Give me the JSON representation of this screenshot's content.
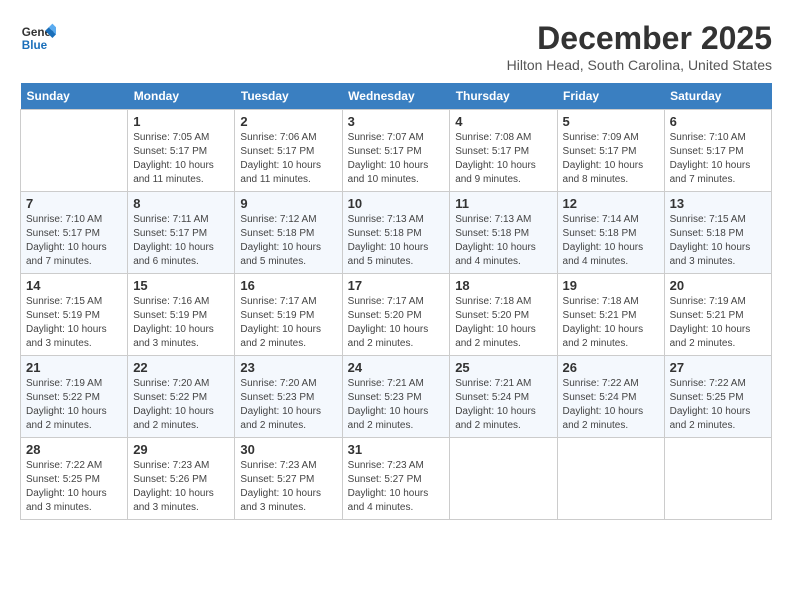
{
  "header": {
    "logo_line1": "General",
    "logo_line2": "Blue",
    "month_title": "December 2025",
    "location": "Hilton Head, South Carolina, United States"
  },
  "days_of_week": [
    "Sunday",
    "Monday",
    "Tuesday",
    "Wednesday",
    "Thursday",
    "Friday",
    "Saturday"
  ],
  "weeks": [
    [
      {
        "num": "",
        "info": ""
      },
      {
        "num": "1",
        "info": "Sunrise: 7:05 AM\nSunset: 5:17 PM\nDaylight: 10 hours and 11 minutes."
      },
      {
        "num": "2",
        "info": "Sunrise: 7:06 AM\nSunset: 5:17 PM\nDaylight: 10 hours and 11 minutes."
      },
      {
        "num": "3",
        "info": "Sunrise: 7:07 AM\nSunset: 5:17 PM\nDaylight: 10 hours and 10 minutes."
      },
      {
        "num": "4",
        "info": "Sunrise: 7:08 AM\nSunset: 5:17 PM\nDaylight: 10 hours and 9 minutes."
      },
      {
        "num": "5",
        "info": "Sunrise: 7:09 AM\nSunset: 5:17 PM\nDaylight: 10 hours and 8 minutes."
      },
      {
        "num": "6",
        "info": "Sunrise: 7:10 AM\nSunset: 5:17 PM\nDaylight: 10 hours and 7 minutes."
      }
    ],
    [
      {
        "num": "7",
        "info": "Sunrise: 7:10 AM\nSunset: 5:17 PM\nDaylight: 10 hours and 7 minutes."
      },
      {
        "num": "8",
        "info": "Sunrise: 7:11 AM\nSunset: 5:17 PM\nDaylight: 10 hours and 6 minutes."
      },
      {
        "num": "9",
        "info": "Sunrise: 7:12 AM\nSunset: 5:18 PM\nDaylight: 10 hours and 5 minutes."
      },
      {
        "num": "10",
        "info": "Sunrise: 7:13 AM\nSunset: 5:18 PM\nDaylight: 10 hours and 5 minutes."
      },
      {
        "num": "11",
        "info": "Sunrise: 7:13 AM\nSunset: 5:18 PM\nDaylight: 10 hours and 4 minutes."
      },
      {
        "num": "12",
        "info": "Sunrise: 7:14 AM\nSunset: 5:18 PM\nDaylight: 10 hours and 4 minutes."
      },
      {
        "num": "13",
        "info": "Sunrise: 7:15 AM\nSunset: 5:18 PM\nDaylight: 10 hours and 3 minutes."
      }
    ],
    [
      {
        "num": "14",
        "info": "Sunrise: 7:15 AM\nSunset: 5:19 PM\nDaylight: 10 hours and 3 minutes."
      },
      {
        "num": "15",
        "info": "Sunrise: 7:16 AM\nSunset: 5:19 PM\nDaylight: 10 hours and 3 minutes."
      },
      {
        "num": "16",
        "info": "Sunrise: 7:17 AM\nSunset: 5:19 PM\nDaylight: 10 hours and 2 minutes."
      },
      {
        "num": "17",
        "info": "Sunrise: 7:17 AM\nSunset: 5:20 PM\nDaylight: 10 hours and 2 minutes."
      },
      {
        "num": "18",
        "info": "Sunrise: 7:18 AM\nSunset: 5:20 PM\nDaylight: 10 hours and 2 minutes."
      },
      {
        "num": "19",
        "info": "Sunrise: 7:18 AM\nSunset: 5:21 PM\nDaylight: 10 hours and 2 minutes."
      },
      {
        "num": "20",
        "info": "Sunrise: 7:19 AM\nSunset: 5:21 PM\nDaylight: 10 hours and 2 minutes."
      }
    ],
    [
      {
        "num": "21",
        "info": "Sunrise: 7:19 AM\nSunset: 5:22 PM\nDaylight: 10 hours and 2 minutes."
      },
      {
        "num": "22",
        "info": "Sunrise: 7:20 AM\nSunset: 5:22 PM\nDaylight: 10 hours and 2 minutes."
      },
      {
        "num": "23",
        "info": "Sunrise: 7:20 AM\nSunset: 5:23 PM\nDaylight: 10 hours and 2 minutes."
      },
      {
        "num": "24",
        "info": "Sunrise: 7:21 AM\nSunset: 5:23 PM\nDaylight: 10 hours and 2 minutes."
      },
      {
        "num": "25",
        "info": "Sunrise: 7:21 AM\nSunset: 5:24 PM\nDaylight: 10 hours and 2 minutes."
      },
      {
        "num": "26",
        "info": "Sunrise: 7:22 AM\nSunset: 5:24 PM\nDaylight: 10 hours and 2 minutes."
      },
      {
        "num": "27",
        "info": "Sunrise: 7:22 AM\nSunset: 5:25 PM\nDaylight: 10 hours and 2 minutes."
      }
    ],
    [
      {
        "num": "28",
        "info": "Sunrise: 7:22 AM\nSunset: 5:25 PM\nDaylight: 10 hours and 3 minutes."
      },
      {
        "num": "29",
        "info": "Sunrise: 7:23 AM\nSunset: 5:26 PM\nDaylight: 10 hours and 3 minutes."
      },
      {
        "num": "30",
        "info": "Sunrise: 7:23 AM\nSunset: 5:27 PM\nDaylight: 10 hours and 3 minutes."
      },
      {
        "num": "31",
        "info": "Sunrise: 7:23 AM\nSunset: 5:27 PM\nDaylight: 10 hours and 4 minutes."
      },
      {
        "num": "",
        "info": ""
      },
      {
        "num": "",
        "info": ""
      },
      {
        "num": "",
        "info": ""
      }
    ]
  ]
}
